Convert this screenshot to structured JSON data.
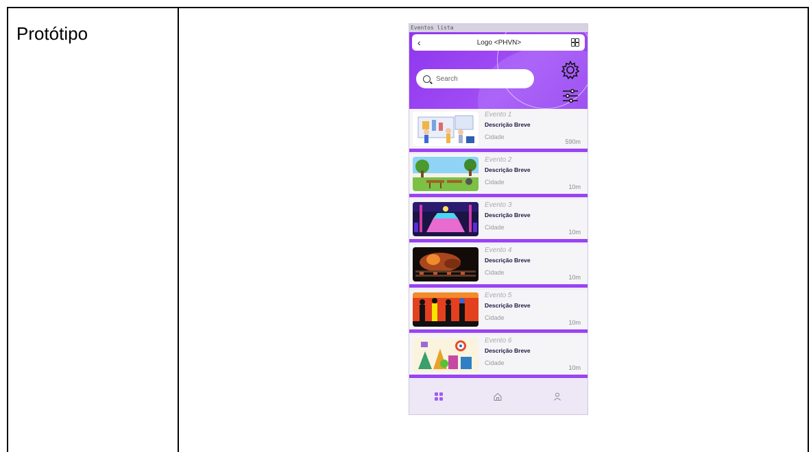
{
  "doc": {
    "label": "Protótipo"
  },
  "frame": {
    "title": "Eventos lista"
  },
  "topbar": {
    "back": "‹",
    "logo": "Logo <PHVN>"
  },
  "search": {
    "placeholder": "Search"
  },
  "events": [
    {
      "name": "Evento 1",
      "description": "Descrição Breve",
      "city": "Cidade",
      "distance": "590m",
      "image": "people-whiteboard-illustration"
    },
    {
      "name": "Evento 2",
      "description": "Descrição Breve",
      "city": "Cidade",
      "distance": "10m",
      "image": "park-picnic-illustration"
    },
    {
      "name": "Evento 3",
      "description": "Descrição Breve",
      "city": "Cidade",
      "distance": "10m",
      "image": "nightclub-dance-floor-photo"
    },
    {
      "name": "Evento 4",
      "description": "Descrição Breve",
      "city": "Cidade",
      "distance": "10m",
      "image": "barbecue-grill-photo"
    },
    {
      "name": "Evento 5",
      "description": "Descrição Breve",
      "city": "Cidade",
      "distance": "10m",
      "image": "band-silhouettes-illustration"
    },
    {
      "name": "Evento 6",
      "description": "Descrição Breve",
      "city": "Cidade",
      "distance": "10m",
      "image": "colorful-festival-illustration"
    }
  ],
  "bottom_nav": [
    "grid-icon",
    "home-icon",
    "user-icon"
  ],
  "colors": {
    "accent": "#9a43f4",
    "header": "#8f36ee",
    "nav_active": "#a35cf0"
  }
}
